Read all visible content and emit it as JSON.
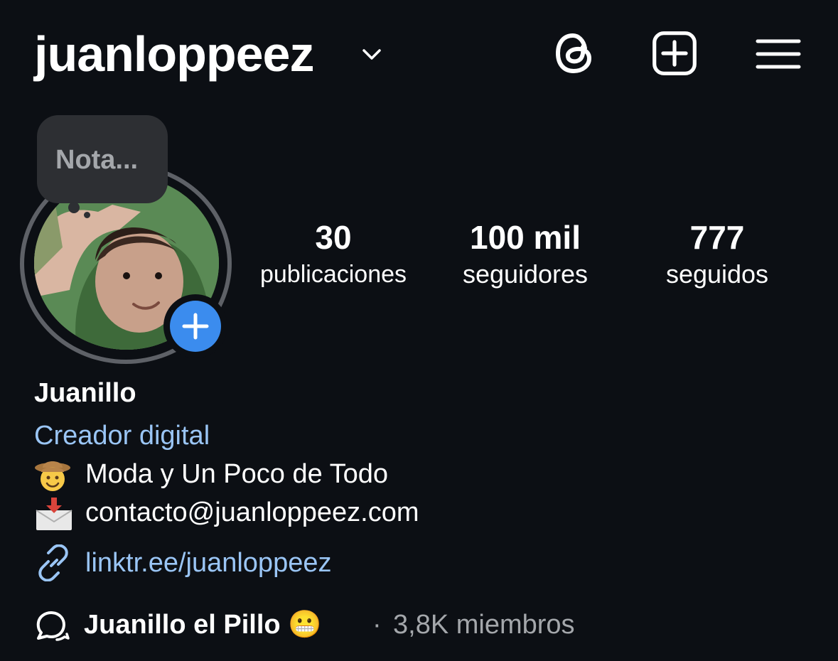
{
  "header": {
    "username": "juanloppeez",
    "icons": [
      "chevron-down-icon",
      "threads-icon",
      "create-post-icon",
      "menu-icon"
    ]
  },
  "profile": {
    "note_placeholder": "Nota...",
    "stats": [
      {
        "value": "30",
        "label": "publicaciones"
      },
      {
        "value": "100 mil",
        "label": "seguidores"
      },
      {
        "value": "777",
        "label": "seguidos"
      }
    ],
    "display_name": "Juanillo",
    "category": "Creador digital",
    "bio": [
      {
        "icon": "cowboy-face-emoji",
        "text": "Moda y Un Poco de Todo"
      },
      {
        "icon": "envelope-arrow-emoji",
        "text": "contacto@juanloppeez.com"
      }
    ],
    "link": "linktr.ee/juanloppeez",
    "channel": {
      "name": "Juanillo el Pillo 😬",
      "separator": "·",
      "members": "3,8K miembros"
    }
  },
  "colors": {
    "background": "#0c0f14",
    "link_blue": "#9ac5f5",
    "add_button_blue": "#3b8cee",
    "muted_text": "#a4a7ab",
    "note_bubble": "#2d2f33"
  }
}
